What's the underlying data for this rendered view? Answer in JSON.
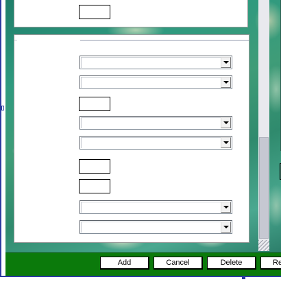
{
  "form": {
    "top_panel": {
      "fields": [
        {
          "value": ""
        }
      ]
    },
    "main_panel": {
      "fields": [
        {
          "kind": "select",
          "value": ""
        },
        {
          "kind": "select",
          "value": ""
        },
        {
          "kind": "text",
          "value": ""
        },
        {
          "kind": "select",
          "value": ""
        },
        {
          "kind": "select",
          "value": ""
        },
        {
          "kind": "text",
          "value": ""
        },
        {
          "kind": "text",
          "value": ""
        },
        {
          "kind": "select",
          "value": ""
        },
        {
          "kind": "select",
          "value": ""
        }
      ]
    }
  },
  "icons": {
    "dropdown": "chevron-down-icon",
    "resize": "resize-grip-icon"
  },
  "toolbar": {
    "add_label": "Add",
    "cancel_label": "Cancel",
    "delete_label": "Delete",
    "fourth_label": "Re"
  },
  "colors": {
    "button_bar": "#0b7a0b",
    "frame_border": "#2b3aa0"
  }
}
